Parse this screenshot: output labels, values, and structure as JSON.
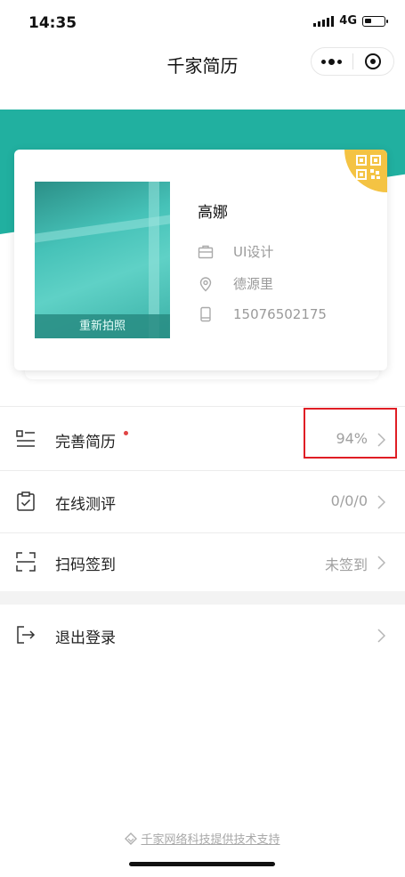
{
  "status": {
    "time": "14:35",
    "network": "4G"
  },
  "nav": {
    "title": "千家简历"
  },
  "profile": {
    "name": "高娜",
    "retake_label": "重新拍照",
    "position": "UI设计",
    "location": "德源里",
    "phone": "15076502175"
  },
  "menu": [
    {
      "label": "完善简历",
      "value": "94%"
    },
    {
      "label": "在线测评",
      "value": "0/0/0"
    },
    {
      "label": "扫码签到",
      "value": "未签到"
    },
    {
      "label": "退出登录",
      "value": ""
    }
  ],
  "footer": {
    "text": "千家网络科技提供技术支持"
  },
  "colors": {
    "accent": "#21b0a0",
    "qr_badge": "#f4c343",
    "alert_dot": "#e04545",
    "highlight": "#e01e25"
  }
}
